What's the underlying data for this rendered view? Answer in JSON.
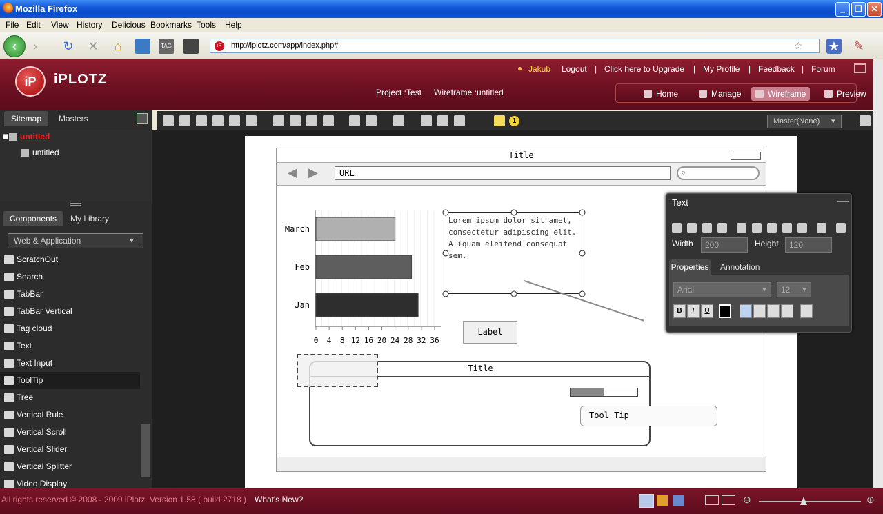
{
  "window": {
    "title": "Mozilla Firefox"
  },
  "menu": [
    "File",
    "Edit",
    "View",
    "History",
    "Delicious",
    "Bookmarks",
    "Tools",
    "Help"
  ],
  "browser": {
    "url": "http://iplotz.com/app/index.php#"
  },
  "app": {
    "logo_text": "iPLOTZ",
    "logo_mark": "iP",
    "user": "Jakub",
    "links": [
      "Logout",
      "Click here to Upgrade",
      "My Profile",
      "Feedback",
      "Forum"
    ],
    "project_label": "Project :Test",
    "wireframe_label": "Wireframe :untitled",
    "nav_tabs": [
      "Home",
      "Manage",
      "Wireframe",
      "Preview"
    ]
  },
  "left": {
    "tabs": [
      "Sitemap",
      "Masters"
    ],
    "tree_root": "untitled",
    "tree_child": "untitled",
    "lib_tabs": [
      "Components",
      "My Library"
    ],
    "category": "Web & Application",
    "components": [
      "ScratchOut",
      "Search",
      "TabBar",
      "TabBar Vertical",
      "Tag cloud",
      "Text",
      "Text Input",
      "ToolTip",
      "Tree",
      "Vertical Rule",
      "Vertical Scroll",
      "Vertical Slider",
      "Vertical Splitter",
      "Video Display"
    ]
  },
  "toolbar": {
    "master": "Master(None)",
    "badge": "1"
  },
  "mock": {
    "title": "Title",
    "url": "URL",
    "lorem": [
      "Lorem ipsum dolor sit amet,",
      "consectetur adipiscing elit.",
      "Aliquam eleifend consequat sem."
    ],
    "label": "Label",
    "panel_title": "Title",
    "tooltip": "Tool Tip"
  },
  "chart_data": {
    "type": "bar",
    "orientation": "horizontal",
    "categories": [
      "March",
      "Feb",
      "Jan"
    ],
    "values": [
      24,
      29,
      31
    ],
    "xticks": [
      "0",
      "4",
      "8",
      "12",
      "16",
      "20",
      "24",
      "28",
      "32",
      "36"
    ],
    "xlim": [
      0,
      36
    ],
    "colors": [
      "#b0b0b0",
      "#5e5e5e",
      "#2e2e2e"
    ]
  },
  "textpanel": {
    "title": "Text",
    "width_label": "Width",
    "width": "200",
    "height_label": "Height",
    "height": "120",
    "tabs": [
      "Properties",
      "Annotation"
    ],
    "font": "Arial",
    "size": "12",
    "bold": "B",
    "italic": "I",
    "underline": "U"
  },
  "footer": {
    "copyright": "All rights reserved © 2008 - 2009 iPlotz. Version 1.58 ( build 2718 )",
    "whats_new": "What's New?"
  }
}
